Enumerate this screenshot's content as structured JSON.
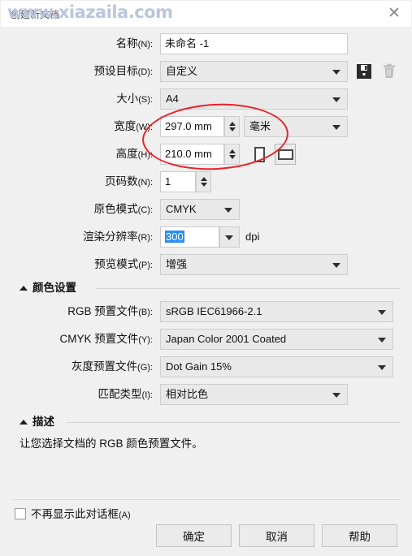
{
  "window": {
    "title": "创建新文档",
    "watermark": "www.xiazaila.com",
    "close_icon": "close-icon"
  },
  "fields": {
    "name": {
      "label": "名称",
      "mnemonic": "(N):",
      "value": "未命名 -1"
    },
    "preset": {
      "label": "预设目标",
      "mnemonic": "(D):",
      "value": "自定义"
    },
    "size": {
      "label": "大小",
      "mnemonic": "(S):",
      "value": "A4"
    },
    "width": {
      "label": "宽度",
      "mnemonic": "(W):",
      "value": "297.0 mm"
    },
    "units": {
      "value": "毫米"
    },
    "height": {
      "label": "高度",
      "mnemonic": "(H):",
      "value": "210.0 mm"
    },
    "pages": {
      "label": "页码数",
      "mnemonic": "(N):",
      "value": "1"
    },
    "color_mode": {
      "label": "原色模式",
      "mnemonic": "(C):",
      "value": "CMYK"
    },
    "resolution": {
      "label": "渲染分辨率",
      "mnemonic": "(R):",
      "value": "300",
      "suffix": "dpi"
    },
    "preview_mode": {
      "label": "预览模式",
      "mnemonic": "(P):",
      "value": "增强"
    }
  },
  "orientation": {
    "portrait_icon": "portrait-orientation-icon",
    "landscape_icon": "landscape-orientation-icon",
    "selected": "landscape"
  },
  "preset_actions": {
    "save_icon": "save-preset-icon",
    "delete_icon": "delete-preset-icon"
  },
  "color_section": {
    "title": "颜色设置",
    "rgb_profile": {
      "label": "RGB 预置文件",
      "mnemonic": "(B):",
      "value": "sRGB IEC61966-2.1"
    },
    "cmyk_profile": {
      "label": "CMYK 预置文件",
      "mnemonic": "(Y):",
      "value": "Japan Color 2001 Coated"
    },
    "gray_profile": {
      "label": "灰度预置文件",
      "mnemonic": "(G):",
      "value": "Dot Gain 15%"
    },
    "rendering_intent": {
      "label": "匹配类型",
      "mnemonic": "(I):",
      "value": "相对比色"
    }
  },
  "description_section": {
    "title": "描述",
    "text": "让您选择文档的 RGB 颜色预置文件。"
  },
  "footer": {
    "dont_show_label": "不再显示此对话框",
    "dont_show_mnemonic": "(A)",
    "dont_show_checked": false,
    "ok_label": "确定",
    "cancel_label": "取消",
    "help_label": "帮助"
  },
  "annotation": {
    "shape": "ellipse",
    "color": "#e8232a"
  }
}
